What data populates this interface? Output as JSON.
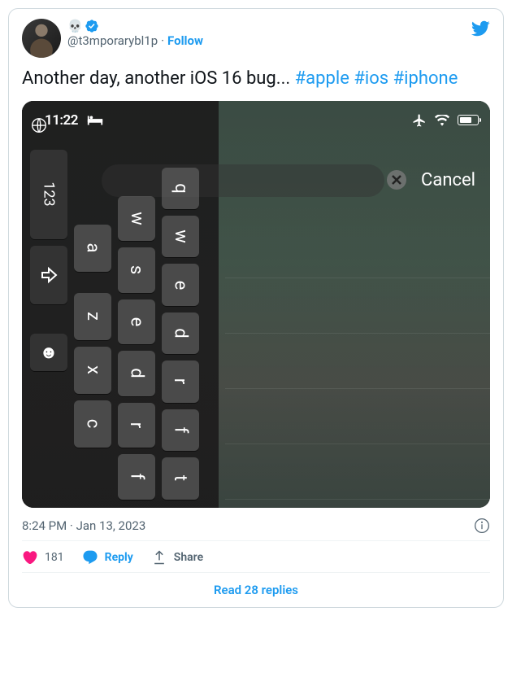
{
  "user": {
    "display_name": "💀",
    "handle": "@t3mporarybl1p",
    "follow_label": "Follow"
  },
  "tweet": {
    "text": "Another day, another iOS 16 bug... ",
    "hashtags": [
      "#apple",
      "#ios",
      "#iphone"
    ],
    "time": "8:24 PM",
    "date": "Jan 13, 2023"
  },
  "image": {
    "status_time": "11:22",
    "cancel_label": "Cancel",
    "keys_col4": [
      "q",
      "w",
      "e",
      "d",
      "r",
      "f",
      "t"
    ],
    "keys_col3": [
      "a",
      "s",
      "e",
      "d",
      "r",
      "f"
    ],
    "keys_col2_num": "123",
    "keys_col2_letters": [
      "z",
      "x",
      "c"
    ],
    "emoji_key": "☻"
  },
  "actions": {
    "like_count": "181",
    "reply_label": "Reply",
    "share_label": "Share",
    "read_replies": "Read 28 replies"
  }
}
